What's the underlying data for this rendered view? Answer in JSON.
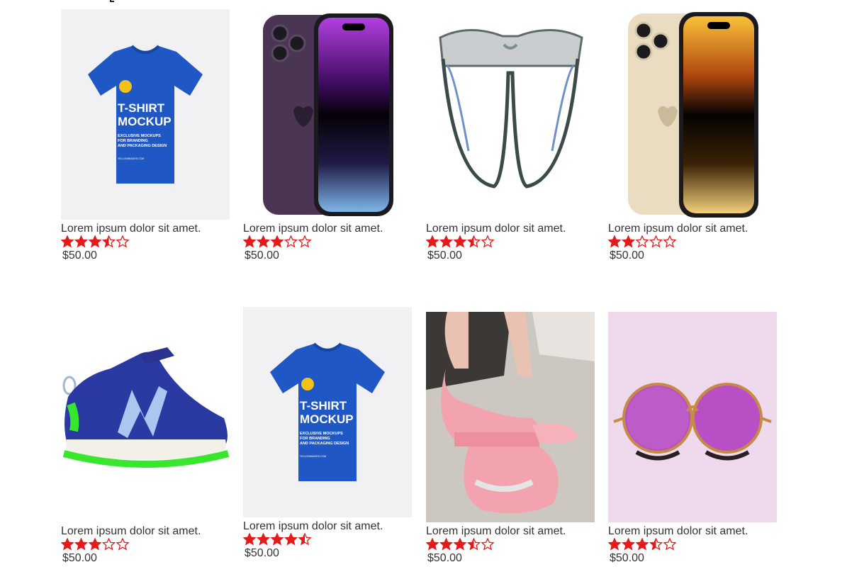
{
  "colors": {
    "star": "#e31b1b",
    "text": "#333333"
  },
  "products": [
    {
      "title": "Lorem ipsum dolor sit amet.",
      "price": "$50.00",
      "rating": 3.5,
      "image": "blue-tshirt-mockup"
    },
    {
      "title": "Lorem ipsum dolor sit amet.",
      "price": "$50.00",
      "rating": 3,
      "image": "purple-iphone"
    },
    {
      "title": "Lorem ipsum dolor sit amet.",
      "price": "$50.00",
      "rating": 3.5,
      "image": "crystal-glasses"
    },
    {
      "title": "Lorem ipsum dolor sit amet.",
      "price": "$50.00",
      "rating": 2,
      "image": "gold-iphone"
    },
    {
      "title": "Lorem ipsum dolor sit amet.",
      "price": "$50.00",
      "rating": 3,
      "image": "blue-sneaker"
    },
    {
      "title": "Lorem ipsum dolor sit amet.",
      "price": "$50.00",
      "rating": 4.5,
      "image": "blue-tshirt-mockup"
    },
    {
      "title": "Lorem ipsum dolor sit amet.",
      "price": "$50.00",
      "rating": 3.5,
      "image": "pink-platform-sneakers"
    },
    {
      "title": "Lorem ipsum dolor sit amet.",
      "price": "$50.00",
      "rating": 3.5,
      "image": "pink-round-sunglasses"
    }
  ],
  "tshirt_print": {
    "line1": "T-SHIRT",
    "line2": "MOCKUP",
    "line3": "EXCLUSIVE MOCKUPS",
    "line4": "FOR BRANDING",
    "line5": "AND PACKAGING DESIGN",
    "line6": "YELLOWIMAGES.COM"
  }
}
